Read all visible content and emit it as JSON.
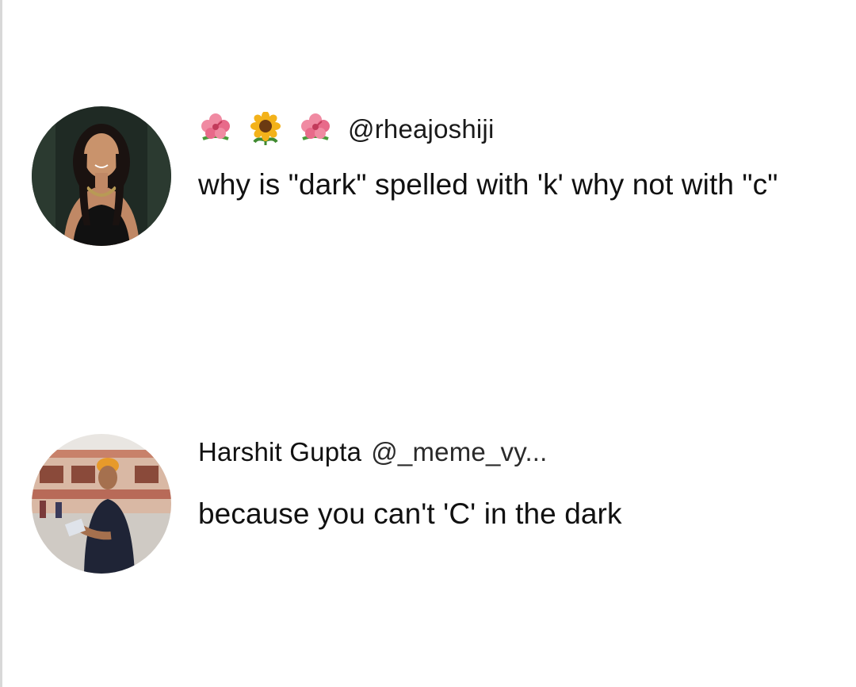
{
  "posts": [
    {
      "author_handle": "@rheajoshiji",
      "name_emojis": [
        "hibiscus-icon",
        "sunflower-icon",
        "hibiscus-icon"
      ],
      "text": "why is \"dark\" spelled with 'k' why not with \"c\""
    },
    {
      "display_name": "Harshit Gupta",
      "author_handle": "@_meme_vy...",
      "text": "because you can't 'C' in the dark"
    }
  ],
  "colors": {
    "background": "#ffffff",
    "text": "#111111",
    "hibiscus": "#e86a8a",
    "sunflower": "#f3b21a"
  }
}
